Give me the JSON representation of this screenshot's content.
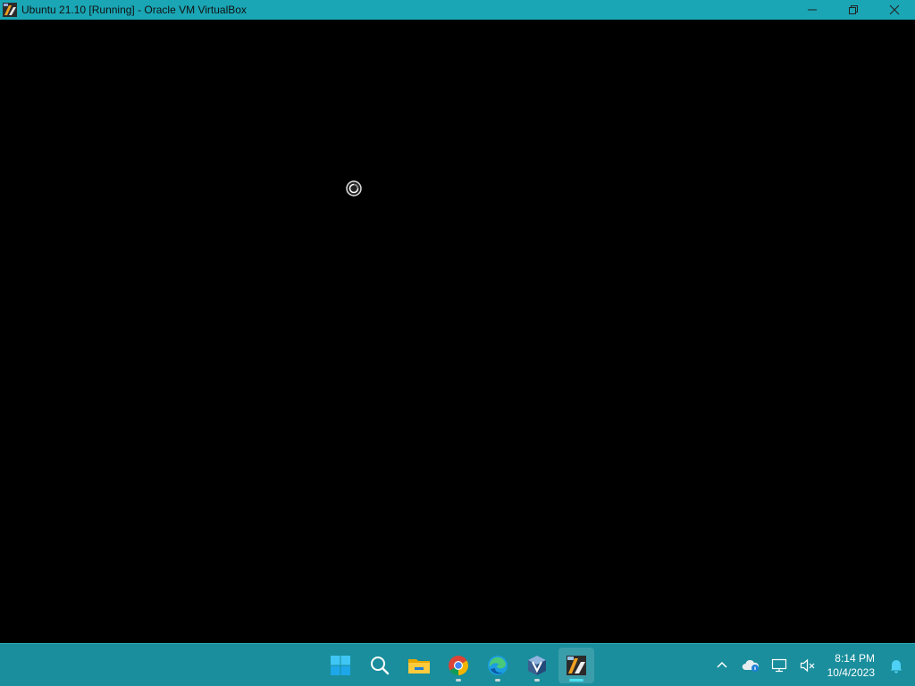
{
  "window": {
    "title": "Ubuntu 21.10 [Running] - Oracle VM VirtualBox",
    "app_icon": "virtualbox-vm-icon",
    "controls": {
      "minimize": "minimize-icon",
      "restore": "restore-icon",
      "close": "close-icon"
    },
    "accent_color": "#1aa6b5"
  },
  "vm_screen": {
    "background": "#000000",
    "cursor": "busy-cursor-icon"
  },
  "taskbar": {
    "background": "#1a8e9c",
    "pinned": [
      {
        "name": "start",
        "icon": "windows-start-icon",
        "running": false
      },
      {
        "name": "search",
        "icon": "search-icon",
        "running": false
      },
      {
        "name": "file-explorer",
        "icon": "folder-icon",
        "running": false
      },
      {
        "name": "chrome",
        "icon": "chrome-icon",
        "running": true
      },
      {
        "name": "edge",
        "icon": "edge-icon",
        "running": true
      },
      {
        "name": "virtualbox",
        "icon": "virtualbox-icon",
        "running": true
      },
      {
        "name": "virtualbox-vm",
        "icon": "virtualbox-vm-icon",
        "running": true,
        "active": true
      }
    ],
    "tray": {
      "overflow": "chevron-up-icon",
      "onedrive": "cloud-icon",
      "network": "network-icon",
      "volume": "speaker-muted-icon",
      "notifications": "bell-icon"
    },
    "clock": {
      "time": "8:14 PM",
      "date": "10/4/2023"
    }
  }
}
